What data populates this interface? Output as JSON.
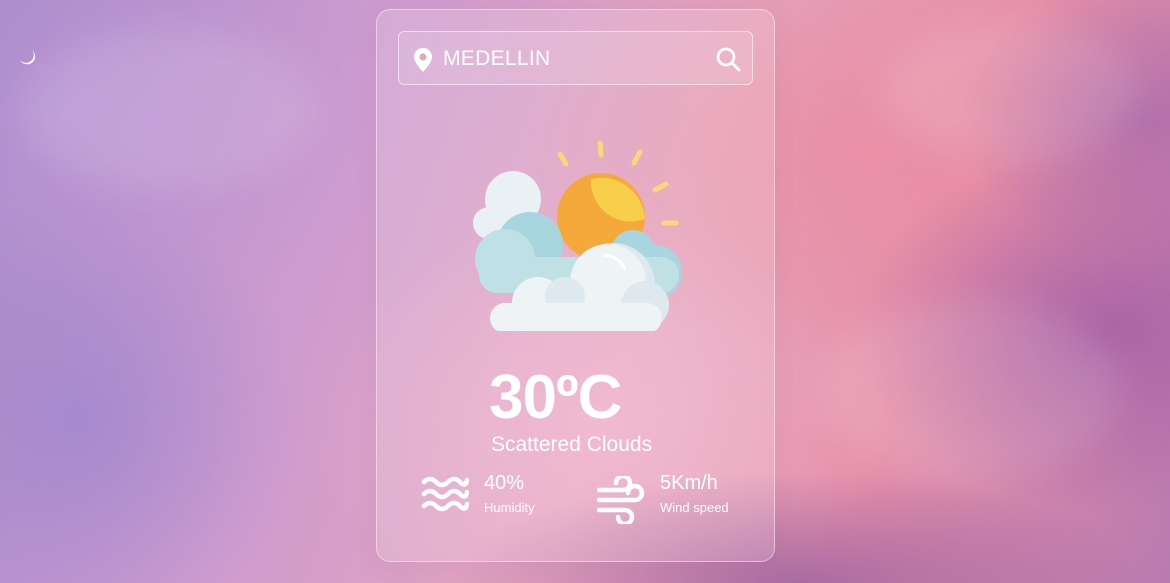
{
  "search": {
    "value": "MEDELLIN",
    "location_icon": "map-pin-icon",
    "button_icon": "search-icon"
  },
  "weather": {
    "icon": "sun-behind-clouds-icon",
    "temperature": "30ºC",
    "description": "Scattered Clouds"
  },
  "details": {
    "humidity": {
      "value": "40%",
      "label": "Humidity",
      "icon": "humidity-waves-icon"
    },
    "wind": {
      "value": "5Km/h",
      "label": "Wind speed",
      "icon": "wind-icon"
    }
  },
  "colors": {
    "text": "#ffffff",
    "sun": "#f5b93e",
    "cloud": "#eef4f6",
    "cloud_shade": "#a8d6de"
  }
}
